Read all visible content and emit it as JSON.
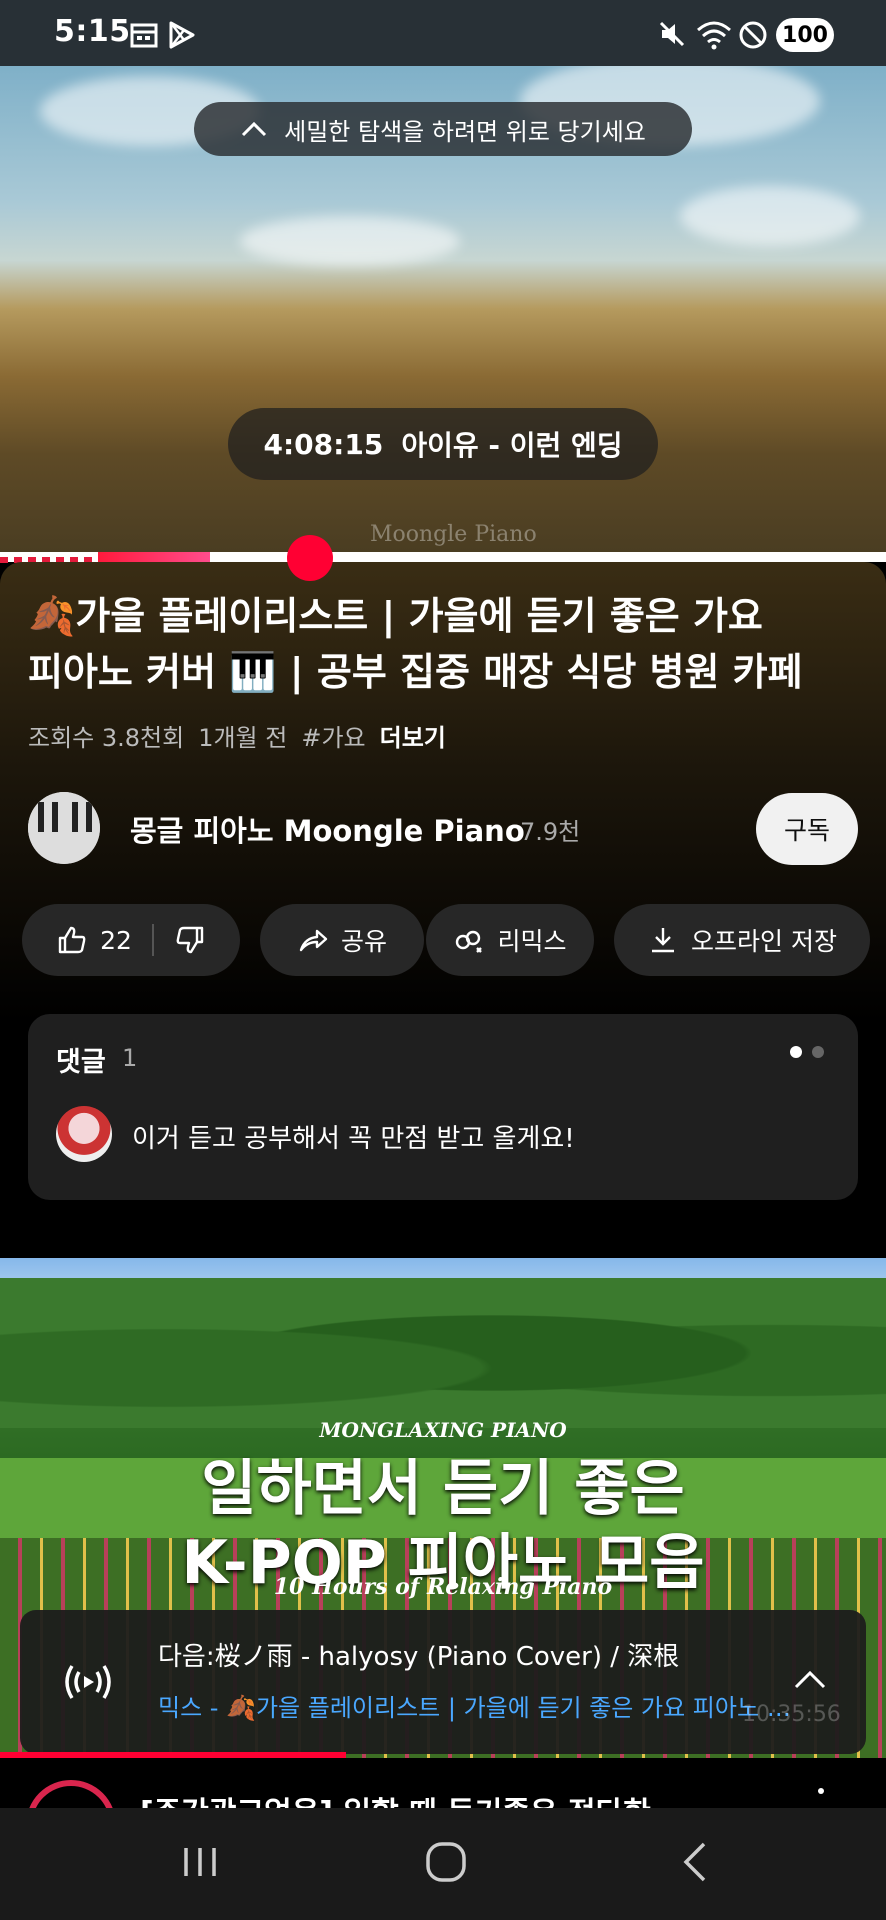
{
  "status_bar": {
    "time": "5:15",
    "battery": "100",
    "icons": [
      "calendar-icon",
      "play-store-icon",
      "mute-icon",
      "wifi-icon",
      "dnd-icon"
    ]
  },
  "player": {
    "pull_hint": "세밀한 탐색을 하려면 위로 당기세요",
    "seek_time": "4:08:15",
    "chapter": "아이유 - 이런 엔딩",
    "watermark": "Moongle Piano",
    "progress_fraction": 0.35
  },
  "video": {
    "title_line1": "🍂가을 플레이리스트 | 가을에 듣기 좋은 가요",
    "title_line2": "피아노 커버 🎹 | 공부 집중 매장 식당 병원 카페",
    "views": "조회수 3.8천회",
    "age": "1개월 전",
    "hashtag": "#가요",
    "more": "더보기"
  },
  "channel": {
    "name": "몽글 피아노 Moongle Piano",
    "subscribers": "7.9천",
    "subscribe_label": "구독"
  },
  "actions": {
    "like_count": "22",
    "share": "공유",
    "remix": "리믹스",
    "download": "오프라인 저장"
  },
  "comments": {
    "header": "댓글",
    "count": "1",
    "top_comment": "이거 듣고 공부해서 꼭 만점 받고 올게요!"
  },
  "next_thumbnail": {
    "brand": "MONGLAXING PIANO",
    "line1": "일하면서 듣기 좋은",
    "line2": "K-POP 피아노 모음",
    "subtitle": "10 Hours  of Relaxing Piano"
  },
  "miniplayer": {
    "next": "다음:桜ノ雨 - halyosy (Piano Cover) / 深根",
    "mix": "믹스 - 🍂가을 플레이리스트 | 가을에 듣기 좋은 가요 피아노 커버",
    "duration_hint": "10:35:56"
  },
  "next_item": {
    "title": "[주간광고없음] 일할 때 듣기좋은 정다한"
  },
  "colors": {
    "accent_red": "#ff0033",
    "link_blue": "#4aa8ff",
    "surface": "#272727"
  }
}
